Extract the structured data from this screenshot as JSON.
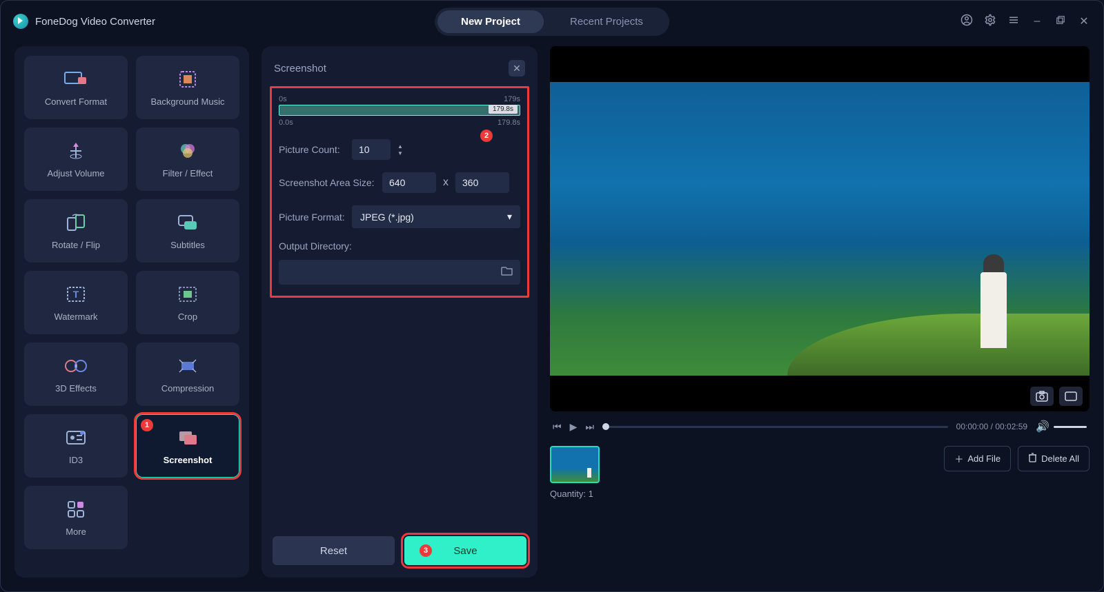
{
  "app": {
    "title": "FoneDog Video Converter"
  },
  "tabs": {
    "new_project": "New Project",
    "recent_projects": "Recent Projects"
  },
  "tools": [
    {
      "label": "Convert Format",
      "icon": "convert-icon"
    },
    {
      "label": "Background Music",
      "icon": "music-icon"
    },
    {
      "label": "Adjust Volume",
      "icon": "volume-icon"
    },
    {
      "label": "Filter / Effect",
      "icon": "filter-icon"
    },
    {
      "label": "Rotate / Flip",
      "icon": "rotate-icon"
    },
    {
      "label": "Subtitles",
      "icon": "subtitles-icon"
    },
    {
      "label": "Watermark",
      "icon": "watermark-icon"
    },
    {
      "label": "Crop",
      "icon": "crop-icon"
    },
    {
      "label": "3D Effects",
      "icon": "3d-icon"
    },
    {
      "label": "Compression",
      "icon": "compress-icon"
    },
    {
      "label": "ID3",
      "icon": "id3-icon"
    },
    {
      "label": "Screenshot",
      "icon": "screenshot-icon"
    },
    {
      "label": "More",
      "icon": "more-icon"
    }
  ],
  "panel": {
    "title": "Screenshot",
    "range": {
      "start_top": "0s",
      "end_top": "179s",
      "bubble": "179.8s",
      "start_bottom": "0.0s",
      "end_bottom": "179.8s"
    },
    "picture_count_label": "Picture Count:",
    "picture_count_value": "10",
    "area_size_label": "Screenshot Area Size:",
    "area_w": "640",
    "area_x": "x",
    "area_h": "360",
    "format_label": "Picture Format:",
    "format_value": "JPEG (*.jpg)",
    "outdir_label": "Output Directory:",
    "reset": "Reset",
    "save": "Save"
  },
  "preview": {
    "time": "00:00:00 / 00:02:59",
    "add_file": "Add File",
    "delete_all": "Delete All",
    "quantity": "Quantity: 1"
  },
  "annotations": {
    "a1": "1",
    "a2": "2",
    "a3": "3"
  }
}
